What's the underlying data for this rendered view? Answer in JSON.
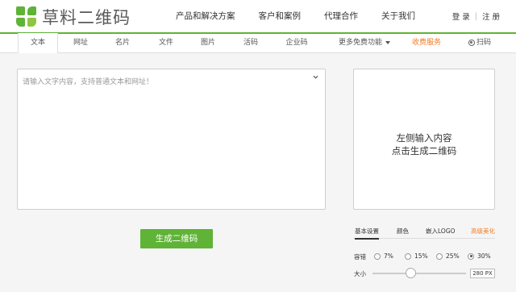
{
  "brand": {
    "name": "草料二维码",
    "color": "#5fb336"
  },
  "topnav": [
    "产品和解决方案",
    "客户和案例",
    "代理合作",
    "关于我们"
  ],
  "auth": {
    "login": "登 录",
    "sep": "|",
    "register": "注 册"
  },
  "tabs": [
    {
      "label": "文本",
      "active": true
    },
    {
      "label": "网址"
    },
    {
      "label": "名片"
    },
    {
      "label": "文件"
    },
    {
      "label": "图片"
    },
    {
      "label": "活码"
    },
    {
      "label": "企业码"
    },
    {
      "label": "更多免费功能"
    },
    {
      "label": "收费服务"
    },
    {
      "label": "扫码"
    }
  ],
  "editor": {
    "placeholder": "请输入文字内容，支持普通文本和网址！",
    "chevron_icon": "chevron-down-icon"
  },
  "generate_button": "生成二维码",
  "preview": {
    "line1": "左侧输入内容",
    "line2": "点击生成二维码"
  },
  "settings": {
    "tabs": [
      "基本设置",
      "颜色",
      "嵌入LOGO",
      "高级美化"
    ],
    "fault_tolerance": {
      "label": "容错",
      "options": [
        "7%",
        "15%",
        "25%",
        "30%"
      ],
      "selected": "30%"
    },
    "size": {
      "label": "大小",
      "value": "280 PX"
    }
  },
  "colors": {
    "accent": "#5fb336",
    "orange": "#f07c28",
    "background": "#f5f5f5"
  }
}
